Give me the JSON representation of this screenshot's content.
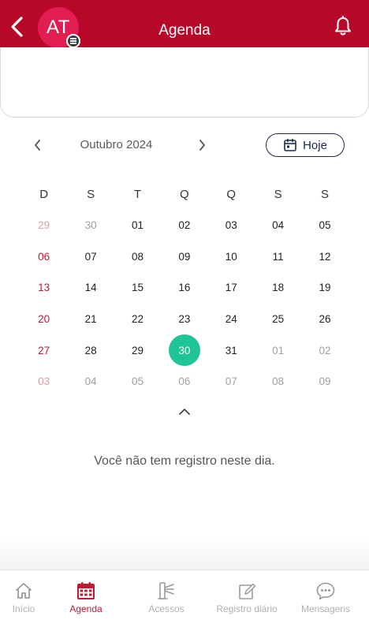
{
  "header": {
    "title": "Agenda",
    "avatar_initials": "AT"
  },
  "calendar": {
    "month_label": "Outubro 2024",
    "today_label": "Hoje",
    "weekdays": [
      "D",
      "S",
      "T",
      "Q",
      "Q",
      "S",
      "S"
    ],
    "weeks": [
      [
        "29",
        "30",
        "01",
        "02",
        "03",
        "04",
        "05"
      ],
      [
        "06",
        "07",
        "08",
        "09",
        "10",
        "11",
        "12"
      ],
      [
        "13",
        "14",
        "15",
        "16",
        "17",
        "18",
        "19"
      ],
      [
        "20",
        "21",
        "22",
        "23",
        "24",
        "25",
        "26"
      ],
      [
        "27",
        "28",
        "29",
        "30",
        "31",
        "01",
        "02"
      ],
      [
        "03",
        "04",
        "05",
        "06",
        "07",
        "08",
        "09"
      ]
    ],
    "selected_day": "30"
  },
  "empty_message": "Você não tem registro neste dia.",
  "nav": {
    "items": [
      {
        "label": "Início",
        "icon": "home-icon"
      },
      {
        "label": "Agenda",
        "icon": "calendar-icon"
      },
      {
        "label": "Acessos",
        "icon": "turnstile-icon"
      },
      {
        "label": "Registro diário",
        "icon": "edit-icon"
      },
      {
        "label": "Mensagens",
        "icon": "chat-icon"
      }
    ],
    "active_index": 1
  },
  "colors": {
    "header": "#b8082a",
    "avatar": "#e11d52",
    "selected_day": "#1fc597",
    "sunday": "#c21834",
    "active_nav": "#c21834"
  }
}
